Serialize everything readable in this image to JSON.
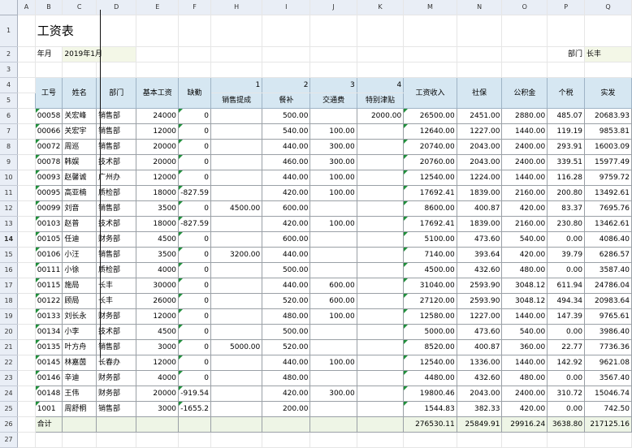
{
  "columns": [
    "",
    "A",
    "B",
    "C",
    "D",
    "E",
    "F",
    "H",
    "I",
    "J",
    "K",
    "M",
    "N",
    "O",
    "P",
    "Q"
  ],
  "sheet": {
    "title": "工资表",
    "month_label": "年月",
    "month_value": "2019年1月",
    "dept_label": "部门",
    "dept_value": "长丰",
    "header_numbers": {
      "h": "1",
      "i": "2",
      "j": "3",
      "k": "4"
    },
    "headers": {
      "id": "工号",
      "name": "姓名",
      "dept": "部门",
      "base": "基本工资",
      "absence": "缺勤",
      "sales": "销售提成",
      "meal": "餐补",
      "traffic": "交通费",
      "special": "特别津贴",
      "income": "工资收入",
      "social": "社保",
      "fund": "公积金",
      "tax": "个税",
      "net": "实发"
    },
    "rows": [
      {
        "id": "00058",
        "name": "关宏峰",
        "dept": "销售部",
        "base": "24000",
        "absence": "0",
        "sales": "",
        "meal": "500.00",
        "traffic": "",
        "special": "2000.00",
        "income": "26500.00",
        "social": "2451.00",
        "fund": "2880.00",
        "tax": "485.07",
        "net": "20683.93"
      },
      {
        "id": "00066",
        "name": "关宏宇",
        "dept": "销售部",
        "base": "12000",
        "absence": "0",
        "sales": "",
        "meal": "540.00",
        "traffic": "100.00",
        "special": "",
        "income": "12640.00",
        "social": "1227.00",
        "fund": "1440.00",
        "tax": "119.19",
        "net": "9853.81"
      },
      {
        "id": "00072",
        "name": "周巡",
        "dept": "销售部",
        "base": "20000",
        "absence": "0",
        "sales": "",
        "meal": "440.00",
        "traffic": "300.00",
        "special": "",
        "income": "20740.00",
        "social": "2043.00",
        "fund": "2400.00",
        "tax": "293.91",
        "net": "16003.09"
      },
      {
        "id": "00078",
        "name": "韩娱",
        "dept": "技术部",
        "base": "20000",
        "absence": "0",
        "sales": "",
        "meal": "460.00",
        "traffic": "300.00",
        "special": "",
        "income": "20760.00",
        "social": "2043.00",
        "fund": "2400.00",
        "tax": "339.51",
        "net": "15977.49"
      },
      {
        "id": "00093",
        "name": "赵馨诚",
        "dept": "广州办",
        "base": "12000",
        "absence": "0",
        "sales": "",
        "meal": "440.00",
        "traffic": "100.00",
        "special": "",
        "income": "12540.00",
        "social": "1224.00",
        "fund": "1440.00",
        "tax": "116.28",
        "net": "9759.72"
      },
      {
        "id": "00095",
        "name": "高亚楠",
        "dept": "质检部",
        "base": "18000",
        "absence": "-827.59",
        "sales": "",
        "meal": "420.00",
        "traffic": "100.00",
        "special": "",
        "income": "17692.41",
        "social": "1839.00",
        "fund": "2160.00",
        "tax": "200.80",
        "net": "13492.61"
      },
      {
        "id": "00099",
        "name": "刘音",
        "dept": "销售部",
        "base": "3500",
        "absence": "0",
        "sales": "4500.00",
        "meal": "600.00",
        "traffic": "",
        "special": "",
        "income": "8600.00",
        "social": "400.87",
        "fund": "420.00",
        "tax": "83.37",
        "net": "7695.76"
      },
      {
        "id": "00103",
        "name": "赵普",
        "dept": "技术部",
        "base": "18000",
        "absence": "-827.59",
        "sales": "",
        "meal": "420.00",
        "traffic": "100.00",
        "special": "",
        "income": "17692.41",
        "social": "1839.00",
        "fund": "2160.00",
        "tax": "230.80",
        "net": "13462.61"
      },
      {
        "id": "00105",
        "name": "任迪",
        "dept": "财务部",
        "base": "4500",
        "absence": "0",
        "sales": "",
        "meal": "600.00",
        "traffic": "",
        "special": "",
        "income": "5100.00",
        "social": "473.60",
        "fund": "540.00",
        "tax": "0.00",
        "net": "4086.40"
      },
      {
        "id": "00106",
        "name": "小汪",
        "dept": "销售部",
        "base": "3500",
        "absence": "0",
        "sales": "3200.00",
        "meal": "440.00",
        "traffic": "",
        "special": "",
        "income": "7140.00",
        "social": "393.64",
        "fund": "420.00",
        "tax": "39.79",
        "net": "6286.57"
      },
      {
        "id": "00111",
        "name": "小徐",
        "dept": "质检部",
        "base": "4000",
        "absence": "0",
        "sales": "",
        "meal": "500.00",
        "traffic": "",
        "special": "",
        "income": "4500.00",
        "social": "432.60",
        "fund": "480.00",
        "tax": "0.00",
        "net": "3587.40"
      },
      {
        "id": "00115",
        "name": "施局",
        "dept": "长丰",
        "base": "30000",
        "absence": "0",
        "sales": "",
        "meal": "440.00",
        "traffic": "600.00",
        "special": "",
        "income": "31040.00",
        "social": "2593.90",
        "fund": "3048.12",
        "tax": "611.94",
        "net": "24786.04"
      },
      {
        "id": "00122",
        "name": "顾局",
        "dept": "长丰",
        "base": "26000",
        "absence": "0",
        "sales": "",
        "meal": "520.00",
        "traffic": "600.00",
        "special": "",
        "income": "27120.00",
        "social": "2593.90",
        "fund": "3048.12",
        "tax": "494.34",
        "net": "20983.64"
      },
      {
        "id": "00133",
        "name": "刘长永",
        "dept": "财务部",
        "base": "12000",
        "absence": "0",
        "sales": "",
        "meal": "480.00",
        "traffic": "100.00",
        "special": "",
        "income": "12580.00",
        "social": "1227.00",
        "fund": "1440.00",
        "tax": "147.39",
        "net": "9765.61"
      },
      {
        "id": "00134",
        "name": "小李",
        "dept": "技术部",
        "base": "4500",
        "absence": "0",
        "sales": "",
        "meal": "500.00",
        "traffic": "",
        "special": "",
        "income": "5000.00",
        "social": "473.60",
        "fund": "540.00",
        "tax": "0.00",
        "net": "3986.40"
      },
      {
        "id": "00135",
        "name": "叶方舟",
        "dept": "销售部",
        "base": "3000",
        "absence": "0",
        "sales": "5000.00",
        "meal": "520.00",
        "traffic": "",
        "special": "",
        "income": "8520.00",
        "social": "400.87",
        "fund": "360.00",
        "tax": "22.77",
        "net": "7736.36"
      },
      {
        "id": "00145",
        "name": "林嘉茵",
        "dept": "长春办",
        "base": "12000",
        "absence": "0",
        "sales": "",
        "meal": "440.00",
        "traffic": "100.00",
        "special": "",
        "income": "12540.00",
        "social": "1336.00",
        "fund": "1440.00",
        "tax": "142.92",
        "net": "9621.08"
      },
      {
        "id": "00146",
        "name": "辛迪",
        "dept": "财务部",
        "base": "4000",
        "absence": "0",
        "sales": "",
        "meal": "480.00",
        "traffic": "",
        "special": "",
        "income": "4480.00",
        "social": "432.60",
        "fund": "480.00",
        "tax": "0.00",
        "net": "3567.40"
      },
      {
        "id": "00148",
        "name": "王伟",
        "dept": "财务部",
        "base": "20000",
        "absence": "-919.54",
        "sales": "",
        "meal": "420.00",
        "traffic": "300.00",
        "special": "",
        "income": "19800.46",
        "social": "2043.00",
        "fund": "2400.00",
        "tax": "310.72",
        "net": "15046.74"
      },
      {
        "id": "1001",
        "name": "周舒桐",
        "dept": "销售部",
        "base": "3000",
        "absence": "-1655.2",
        "sales": "",
        "meal": "200.00",
        "traffic": "",
        "special": "",
        "income": "1544.83",
        "social": "382.33",
        "fund": "420.00",
        "tax": "0.00",
        "net": "742.50"
      }
    ],
    "total": {
      "label": "合计",
      "income": "276530.11",
      "social": "25849.91",
      "fund": "29916.24",
      "tax": "3638.80",
      "net": "217125.16"
    }
  }
}
